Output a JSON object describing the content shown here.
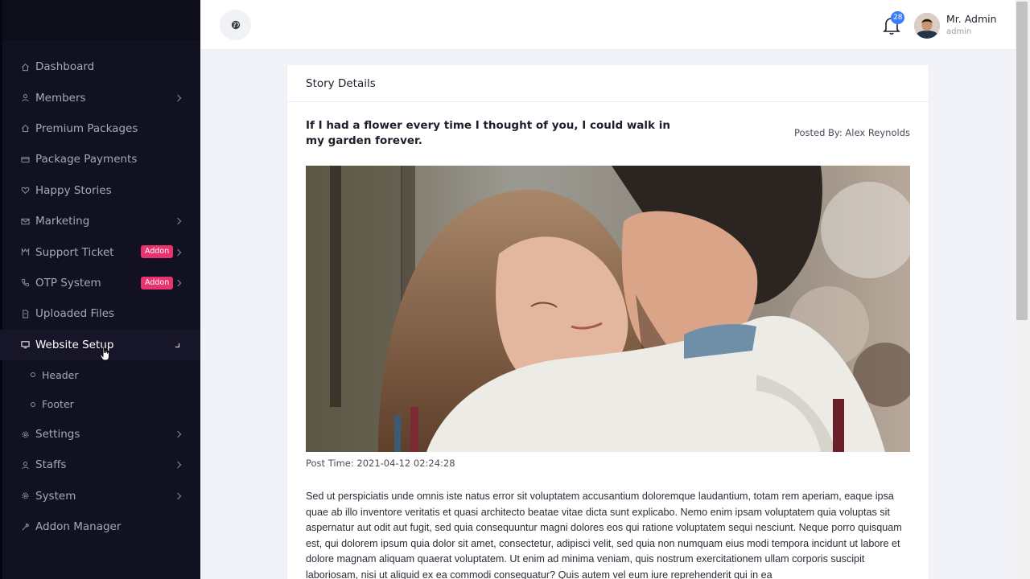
{
  "sidebar": {
    "items": [
      {
        "label": "Dashboard",
        "icon": "home-icon"
      },
      {
        "label": "Members",
        "icon": "user-icon"
      },
      {
        "label": "Premium Packages",
        "icon": "home-icon"
      },
      {
        "label": "Package Payments",
        "icon": "credit-card-icon"
      },
      {
        "label": "Happy Stories",
        "icon": "heart-icon"
      },
      {
        "label": "Marketing",
        "icon": "mail-icon"
      },
      {
        "label": "Support Ticket",
        "icon": "ticket-icon",
        "badge": "Addon"
      },
      {
        "label": "OTP System",
        "icon": "phone-icon",
        "badge": "Addon"
      },
      {
        "label": "Uploaded Files",
        "icon": "file-icon"
      },
      {
        "label": "Website Setup",
        "icon": "monitor-icon"
      },
      {
        "label": "Settings",
        "icon": "gear-icon"
      },
      {
        "label": "Staffs",
        "icon": "user-icon"
      },
      {
        "label": "System",
        "icon": "gear-icon"
      },
      {
        "label": "Addon Manager",
        "icon": "wrench-icon"
      }
    ],
    "website_setup_sub": [
      "Header",
      "Footer"
    ]
  },
  "topbar": {
    "notification_count": "28",
    "user_name": "Mr. Admin",
    "user_role": "admin"
  },
  "story": {
    "header": "Story Details",
    "title": "If I had a flower every time I thought of you, I could walk in my garden forever.",
    "posted_by": "Posted By: Alex Reynolds",
    "post_time": "Post Time: 2021-04-12 02:24:28",
    "body": "Sed ut perspiciatis unde omnis iste natus error sit voluptatem accusantium doloremque laudantium, totam rem aperiam, eaque ipsa quae ab illo inventore veritatis et quasi architecto beatae vitae dicta sunt explicabo. Nemo enim ipsam voluptatem quia voluptas sit aspernatur aut odit aut fugit, sed quia consequuntur magni dolores eos qui ratione voluptatem sequi nesciunt. Neque porro quisquam est, qui dolorem ipsum quia dolor sit amet, consectetur, adipisci velit, sed quia non numquam eius modi tempora incidunt ut labore et dolore magnam aliquam quaerat voluptatem. Ut enim ad minima veniam, quis nostrum exercitationem ullam corporis suscipit laboriosam, nisi ut aliquid ex ea commodi consequatur? Quis autem vel eum iure reprehenderit qui in ea"
  },
  "colors": {
    "sidebar_bg": "#111122",
    "addon_badge": "#e8336f",
    "notification_badge": "#377dff"
  }
}
